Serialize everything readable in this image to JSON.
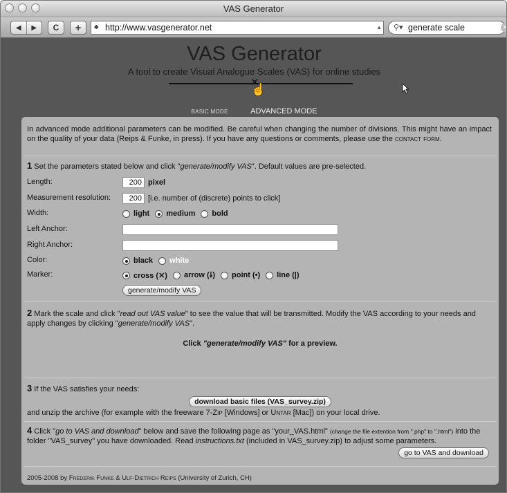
{
  "browser": {
    "window_title": "VAS Generator",
    "url": "http://www.vasgenerator.net",
    "search_value": "generate scale",
    "nav_back": "◀",
    "nav_forward": "▶",
    "reload": "C",
    "new_tab": "+"
  },
  "hero": {
    "title": "VAS Generator",
    "subtitle": "A tool to create Visual Analogue Scales (VAS) for online studies",
    "scale_marker": "✕"
  },
  "modes": {
    "basic": "BASIC MODE",
    "advanced": "ADVANCED MODE"
  },
  "intro": {
    "text": "In advanced mode additional parameters can be modified. Be careful when changing the number of divisions. This might have an impact on the quality of your data (Reips & Funke, in press). If you have any questions or comments, please use the ",
    "link": "contact form",
    "end": "."
  },
  "step1": {
    "num": "1",
    "text_a": " Set the parameters stated below and click \"",
    "text_em": "generate/modify VAS",
    "text_b": "\". Default values are pre-selected.",
    "length_label": "Length:",
    "length_value": "200",
    "length_unit": "pixel",
    "resolution_label": "Measurement resolution:",
    "resolution_value": "200",
    "resolution_hint": "[i.e. number of (discrete) points to click]",
    "width_label": "Width:",
    "width_options": [
      "light",
      "medium",
      "bold"
    ],
    "left_anchor_label": "Left Anchor:",
    "right_anchor_label": "Right Anchor:",
    "color_label": "Color:",
    "color_options": [
      "black",
      "white"
    ],
    "marker_label": "Marker:",
    "marker_options": [
      "cross (✕)",
      "arrow (🠗)",
      "point (•)",
      "line (|)"
    ],
    "generate_button": "generate/modify VAS"
  },
  "step2": {
    "num": "2",
    "text_a": " Mark the scale and click \"",
    "text_em1": "read out VAS value",
    "text_b": "\" to see the value that will be transmitted. Modify the VAS according to your needs and apply changes by clicking \"",
    "text_em2": "generate/modify VAS",
    "text_c": "\".",
    "preview_a": "Click ",
    "preview_em": "\"generate/modify VAS\"",
    "preview_b": " for a preview."
  },
  "step3": {
    "num": "3",
    "text": " If the VAS satisfies your needs:",
    "download_button": "download basic files (VAS_survey.zip)",
    "unzip_a": "and unzip the archive (for example with the freeware ",
    "tool1": "7-Zip",
    "unzip_b": " [Windows] or ",
    "tool2": "Untar",
    "unzip_c": " [Mac]) on your local drive."
  },
  "step4": {
    "num": "4",
    "text_a": " Click \"",
    "text_em1": "go to VAS and download",
    "text_b": "\" below and save the following page as \"your_VAS.html\" ",
    "text_small": "(change the file extention from \".php\" to \".html\")",
    "text_c": " into the folder \"VAS_survey\" you have downloaded. Read ",
    "text_em2": "instructions.txt",
    "text_d": " (included in VAS_survey.zip) to adjust some parameters.",
    "go_button": "go to VAS and download"
  },
  "footer": {
    "years": "2005-2008 by ",
    "author1": "Frederik Funke",
    "amp": " & ",
    "author2": "Ulf-Dietrich Reips",
    "affil": " (University of Zurich, CH)"
  },
  "icons": [
    "hand-pointer-icon",
    "arrow-cursor-icon",
    "search-icon",
    "globe-favicon-icon"
  ]
}
